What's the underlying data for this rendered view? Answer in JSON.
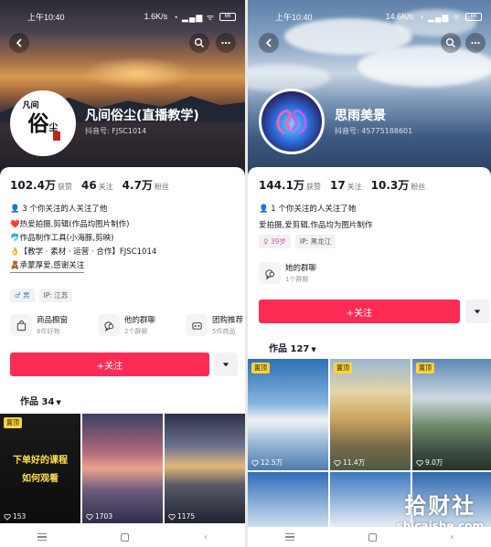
{
  "left": {
    "status": {
      "time": "上午10:40",
      "network": "1.6K/s",
      "battery": "66"
    },
    "user": {
      "name": "凡间俗尘(直播教学)",
      "douyin_id": "抖音号: FJSC1014",
      "avatar_glyph": "俗",
      "avatar_small": "凡间",
      "avatar_side": "尘"
    },
    "stats": [
      {
        "value": "102.4万",
        "label": "获赞"
      },
      {
        "value": "46",
        "label": "关注"
      },
      {
        "value": "4.7万",
        "label": "粉丝"
      }
    ],
    "mutual": "3 个你关注的人关注了他",
    "bio": [
      "❤️热爱拍摄,剪辑(作品均图片制作)",
      "🐬作品制作工具(小海豚,剪映)",
      "👌【教学 · 素材 · 运营 · 合作】FJSC1014",
      "🧸承蒙厚爱,感谢关注"
    ],
    "tags": {
      "gender": "♂ 男",
      "ip": "IP: 江苏"
    },
    "tiles": [
      {
        "title": "商品橱窗",
        "sub": "8件好物",
        "icon": "shopping-bag-icon"
      },
      {
        "title": "他的群聊",
        "sub": "2个群聊",
        "icon": "chat-icon"
      },
      {
        "title": "团购推荐",
        "sub": "5件商品",
        "icon": "group-buy-icon"
      }
    ],
    "follow_label": "+关注",
    "works_label": "作品 34",
    "thumbs": [
      {
        "pin": "置顶",
        "likes": "153",
        "text1": "下单好的课程",
        "text2": "如何观看"
      },
      {
        "likes": "1703"
      },
      {
        "likes": "1175"
      }
    ]
  },
  "right": {
    "status": {
      "time": "上午10:40",
      "network": "14.6K/s",
      "battery": "66"
    },
    "user": {
      "name": "思雨美景",
      "douyin_id": "抖音号: 45775188601"
    },
    "stats": [
      {
        "value": "144.1万",
        "label": "获赞"
      },
      {
        "value": "17",
        "label": "关注"
      },
      {
        "value": "10.3万",
        "label": "粉丝"
      }
    ],
    "mutual": "1 个你关注的人关注了她",
    "bio": [
      "爱拍摄,爱剪辑,作品均为图片制作"
    ],
    "tags": {
      "age": "♀ 39岁",
      "ip": "IP: 黑龙江"
    },
    "tiles": [
      {
        "title": "她的群聊",
        "sub": "1个群聊",
        "icon": "chat-icon"
      }
    ],
    "follow_label": "+关注",
    "works_label": "作品 127",
    "thumbs": [
      {
        "pin": "置顶",
        "likes": "12.5万"
      },
      {
        "pin": "置顶",
        "likes": "11.4万"
      },
      {
        "pin": "置顶",
        "likes": "9.0万"
      }
    ]
  },
  "watermark": {
    "line1": "拾财社",
    "line2": "shicaishe.com"
  },
  "colors": {
    "accent": "#fe2c55",
    "pin": "#fdd23c"
  }
}
